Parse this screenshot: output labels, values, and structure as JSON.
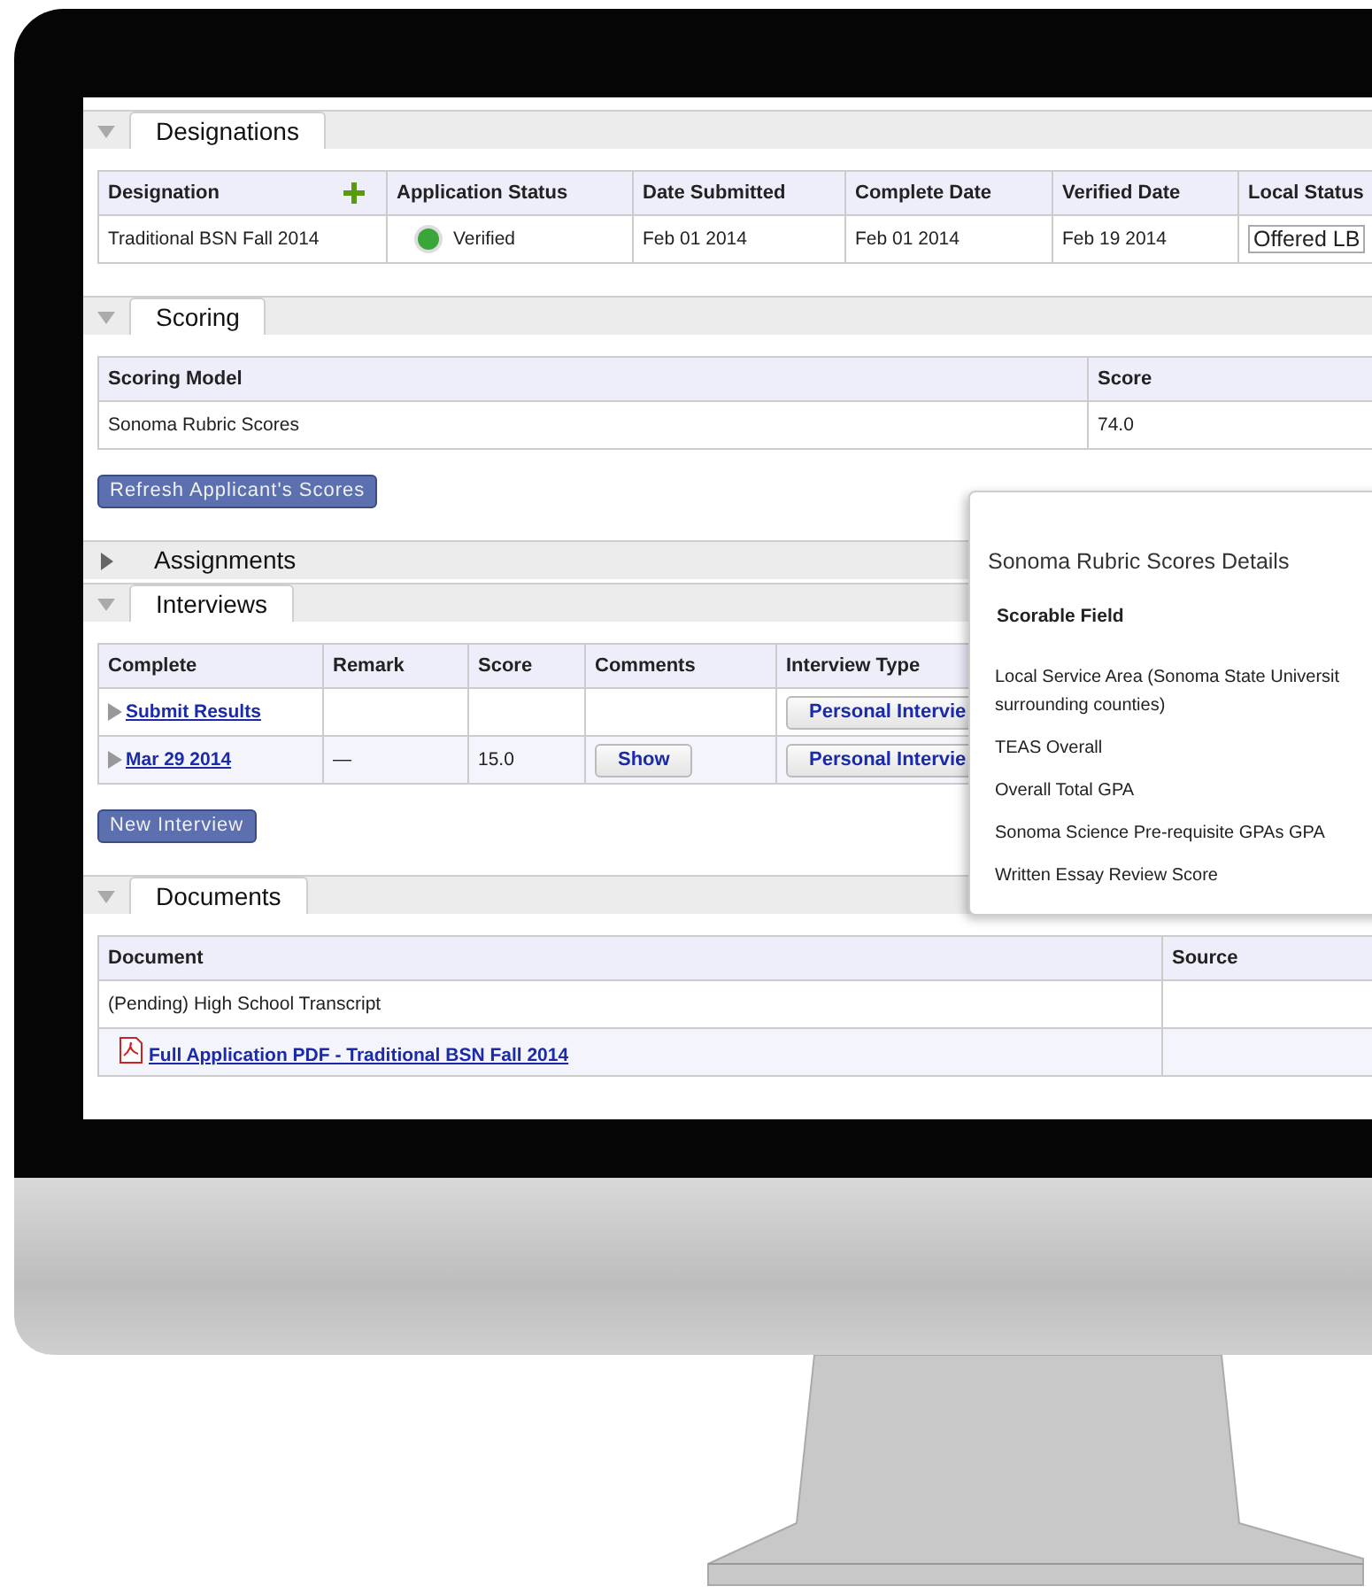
{
  "sections": [
    {
      "title": "Designations",
      "expanded": true,
      "addable": true,
      "columns": [
        "Designation",
        "Application Status",
        "Date Submitted",
        "Complete Date",
        "Verified Date",
        "Local Status"
      ],
      "rows": [
        [
          {
            "kind": "text",
            "text": "Traditional BSN Fall 2014"
          },
          {
            "kind": "status",
            "text": "Verified",
            "color": "#3aa63a"
          },
          {
            "kind": "text",
            "text": "Feb 01 2014"
          },
          {
            "kind": "text",
            "text": "Feb 01 2014"
          },
          {
            "kind": "text",
            "text": "Feb 19 2014"
          },
          {
            "kind": "select",
            "text": "Offered LB"
          }
        ]
      ]
    },
    {
      "title": "Scoring",
      "expanded": true,
      "columns": [
        "Scoring Model",
        "Score"
      ],
      "rows": [
        [
          {
            "kind": "text",
            "text": "Sonoma Rubric Scores"
          },
          {
            "kind": "text",
            "text": "74.0"
          }
        ]
      ],
      "button": "Refresh Applicant's Scores"
    },
    {
      "title": "Assignments",
      "expanded": false
    },
    {
      "title": "Interviews",
      "expanded": true,
      "columns": [
        "Complete",
        "Remark",
        "Score",
        "Comments",
        "Interview Type"
      ],
      "rows": [
        [
          {
            "kind": "expander",
            "text": "Submit Results"
          },
          {
            "kind": "blank"
          },
          {
            "kind": "blank"
          },
          {
            "kind": "blank"
          },
          {
            "kind": "button",
            "text": "Personal Intervie"
          }
        ],
        [
          {
            "kind": "expander",
            "text": "Mar 29 2014"
          },
          {
            "kind": "text",
            "text": "—"
          },
          {
            "kind": "text",
            "text": "15.0"
          },
          {
            "kind": "button",
            "text": "Show"
          },
          {
            "kind": "button",
            "text": "Personal Intervie"
          }
        ]
      ],
      "button": "New Interview"
    },
    {
      "title": "Documents",
      "expanded": true,
      "columns": [
        "Document",
        "Source"
      ],
      "rows": [
        [
          {
            "kind": "text",
            "text": "(Pending) High School Transcript"
          },
          {
            "kind": "blank"
          }
        ],
        [
          {
            "kind": "pdf",
            "text": "Full Application PDF - Traditional BSN Fall 2014"
          },
          {
            "kind": "blank"
          }
        ]
      ]
    }
  ],
  "popup": {
    "title": "Sonoma Rubric Scores Details",
    "column": "Scorable Field",
    "items": [
      {
        "lines": [
          "Local Service Area (Sonoma State Universit",
          "surrounding counties)"
        ]
      },
      {
        "lines": [
          "TEAS Overall"
        ]
      },
      {
        "lines": [
          "Overall Total GPA"
        ]
      },
      {
        "lines": [
          "Sonoma Science Pre-requisite GPAs GPA"
        ]
      },
      {
        "lines": [
          "Written Essay Review Score"
        ]
      }
    ]
  }
}
